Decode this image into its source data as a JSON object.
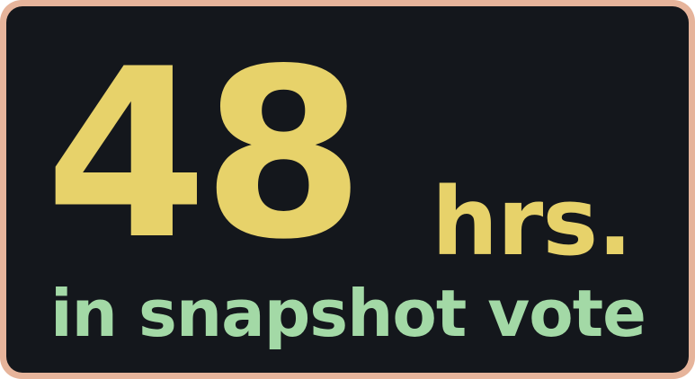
{
  "badge": {
    "number": "48",
    "unit": "hrs.",
    "subtitle": "in snapshot vote"
  },
  "colors": {
    "border": "#e6b49b",
    "background": "#14171c",
    "headline": "#e7d26a",
    "subtitle": "#a3d9a6"
  }
}
